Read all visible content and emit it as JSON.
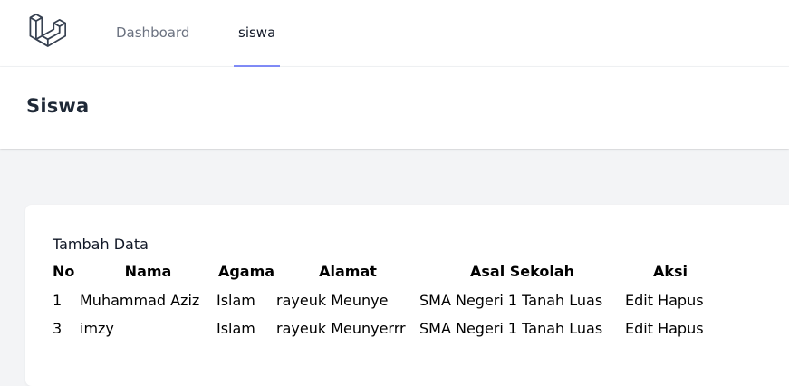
{
  "nav": {
    "links": [
      {
        "label": "Dashboard",
        "active": false
      },
      {
        "label": "siswa",
        "active": true
      }
    ]
  },
  "header": {
    "title": "Siswa"
  },
  "card": {
    "add_label": "Tambah Data",
    "columns": [
      "No",
      "Nama",
      "Agama",
      "Alamat",
      "Asal Sekolah",
      "Aksi"
    ],
    "rows": [
      {
        "no": "1",
        "nama": "Muhammad Aziz",
        "agama": "Islam",
        "alamat": "rayeuk Meunye",
        "sekolah": "SMA Negeri 1 Tanah Luas",
        "edit": "Edit",
        "hapus": "Hapus"
      },
      {
        "no": "3",
        "nama": "imzy",
        "agama": "Islam",
        "alamat": "rayeuk Meunyerrr",
        "sekolah": "SMA Negeri 1 Tanah Luas",
        "edit": "Edit",
        "hapus": "Hapus"
      }
    ]
  },
  "colors": {
    "nav_active_underline": "#818cf8",
    "page_background": "#f3f4f6",
    "nav_inactive_text": "#6b7280"
  }
}
